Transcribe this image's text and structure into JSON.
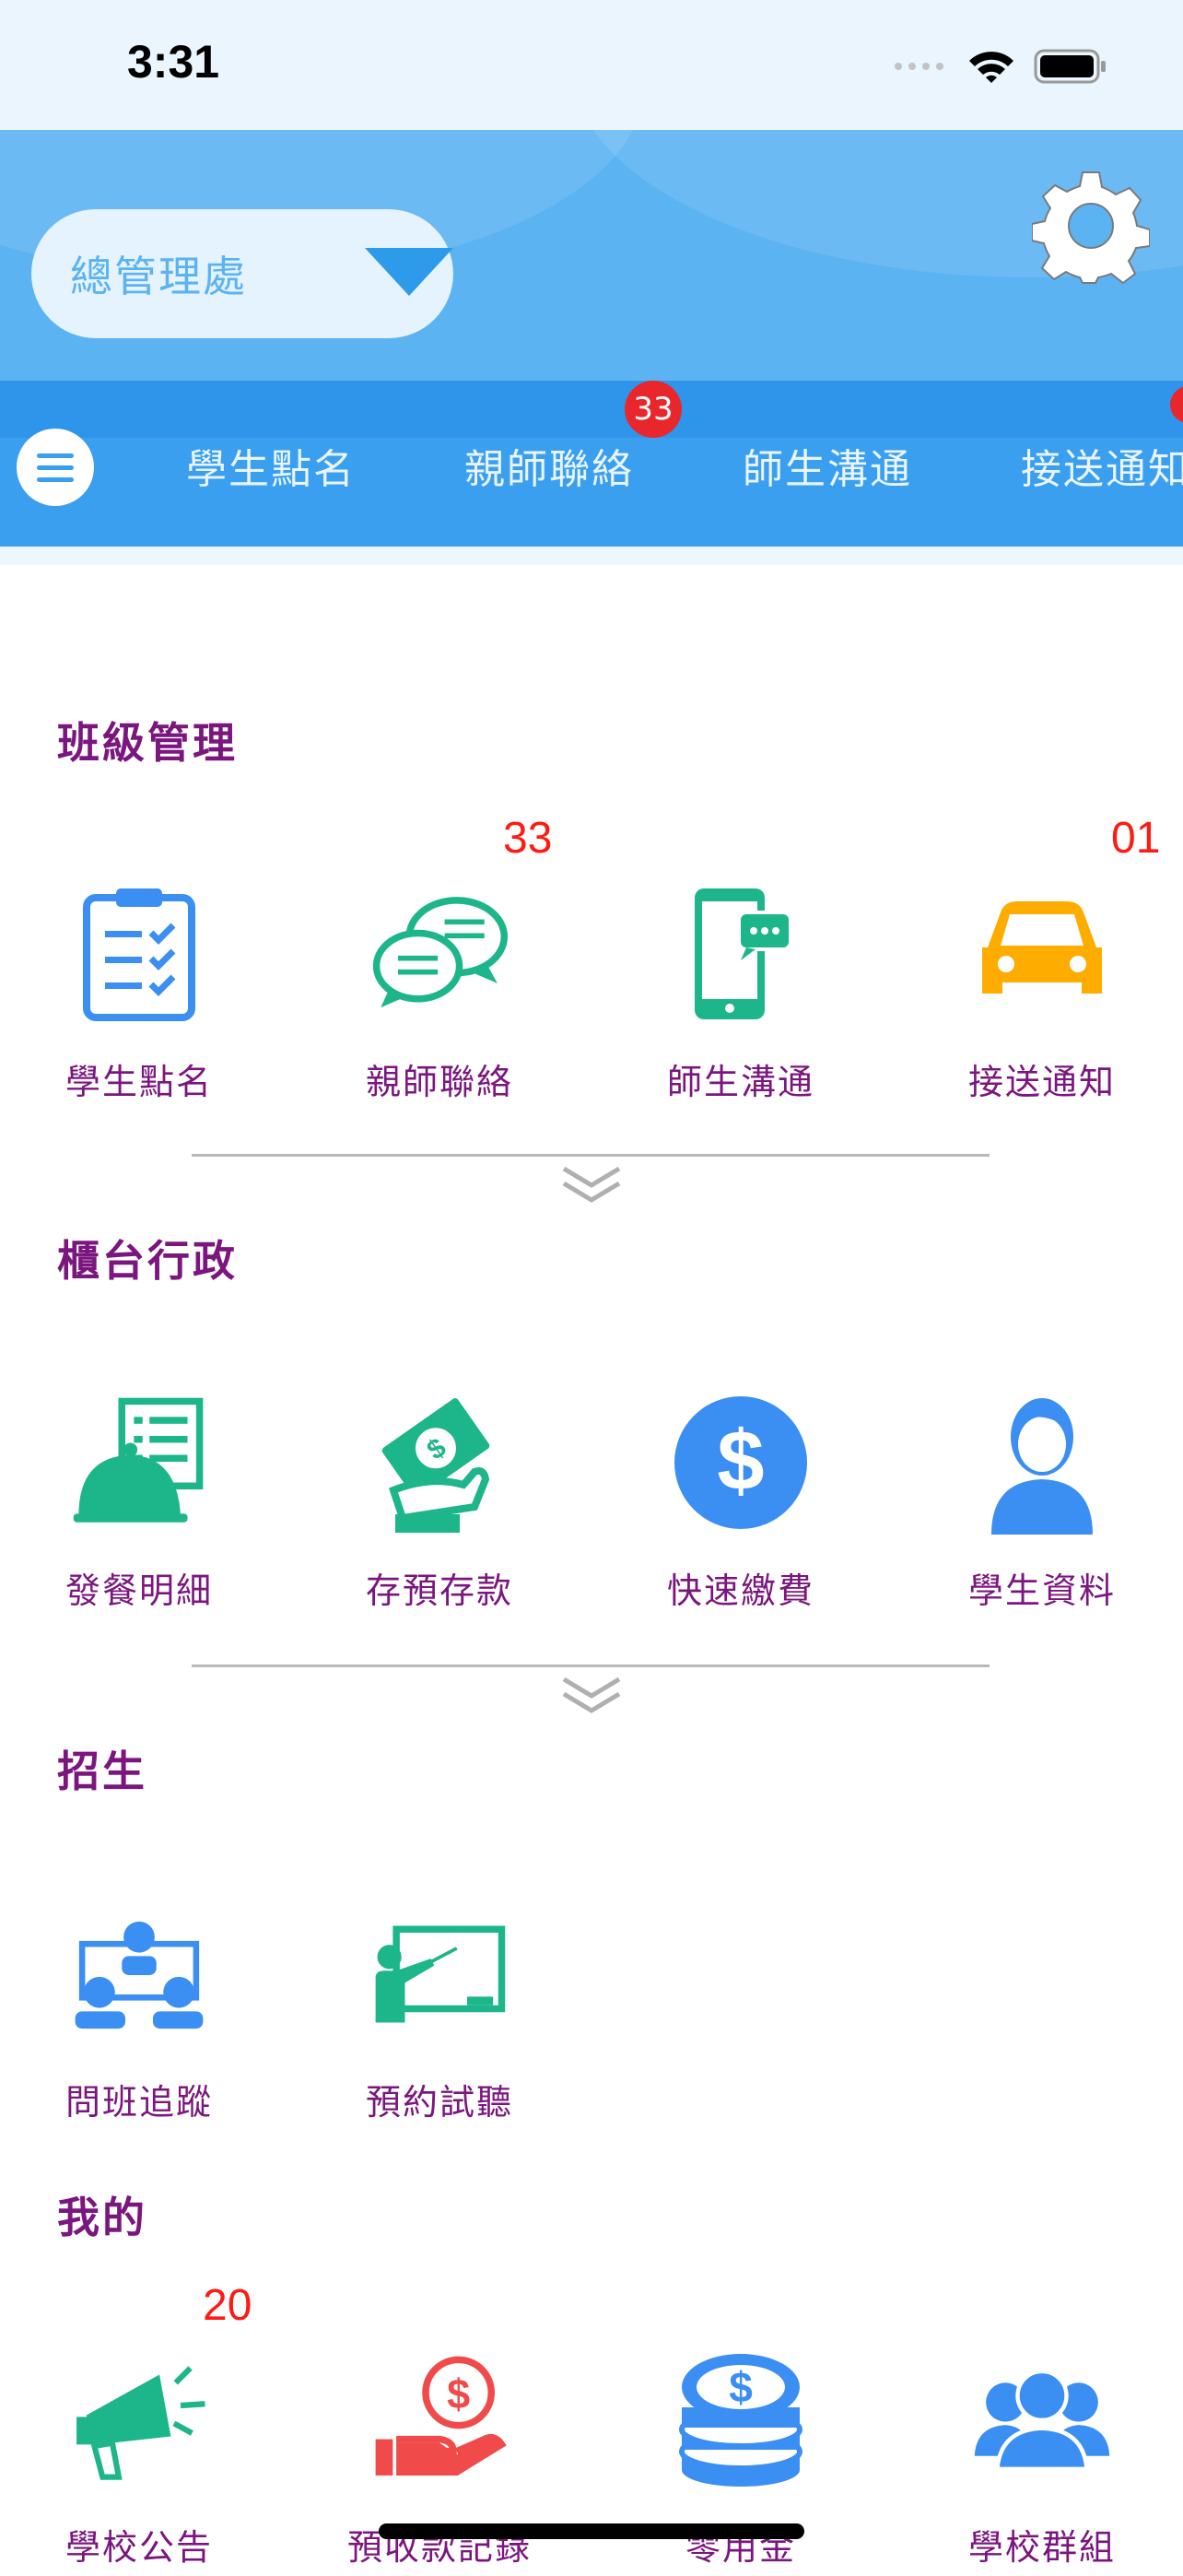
{
  "status_bar": {
    "time": "3:31"
  },
  "header": {
    "school": "總管理處"
  },
  "tabs": [
    {
      "label": "學生點名"
    },
    {
      "label": "親師聯絡",
      "badge": "33"
    },
    {
      "label": "師生溝通"
    },
    {
      "label": "接送通知"
    }
  ],
  "sections": [
    {
      "title": "班級管理",
      "items": [
        {
          "label": "學生點名",
          "icon": "clipboard-checklist-icon",
          "color": "#3b8ff3"
        },
        {
          "label": "親師聯絡",
          "icon": "chat-bubbles-icon",
          "color": "#1db68a",
          "count": "33"
        },
        {
          "label": "師生溝通",
          "icon": "smartphone-message-icon",
          "color": "#1db68a"
        },
        {
          "label": "接送通知",
          "icon": "car-icon",
          "color": "#ffac00",
          "count": "01"
        }
      ]
    },
    {
      "title": "櫃台行政",
      "items": [
        {
          "label": "發餐明細",
          "icon": "meal-list-icon",
          "color": "#1db68a"
        },
        {
          "label": "存預存款",
          "icon": "money-hand-icon",
          "color": "#1db68a"
        },
        {
          "label": "快速繳費",
          "icon": "dollar-coin-icon",
          "color": "#3b8ff3"
        },
        {
          "label": "學生資料",
          "icon": "student-profile-icon",
          "color": "#3b8ff3"
        }
      ]
    },
    {
      "title": "招生",
      "items": [
        {
          "label": "問班追蹤",
          "icon": "group-meeting-icon",
          "color": "#3b8ff3"
        },
        {
          "label": "預約試聽",
          "icon": "teacher-board-icon",
          "color": "#1db68a"
        }
      ]
    },
    {
      "title": "我的",
      "items": [
        {
          "label": "學校公告",
          "icon": "megaphone-icon",
          "color": "#1db68a",
          "count": "20"
        },
        {
          "label": "預收款記錄",
          "icon": "coin-hand-icon",
          "color": "#f04a4a"
        },
        {
          "label": "零用金",
          "icon": "coin-stack-icon",
          "color": "#3b8ff3"
        },
        {
          "label": "學校群組",
          "icon": "people-group-icon",
          "color": "#3b8ff3"
        }
      ]
    }
  ]
}
